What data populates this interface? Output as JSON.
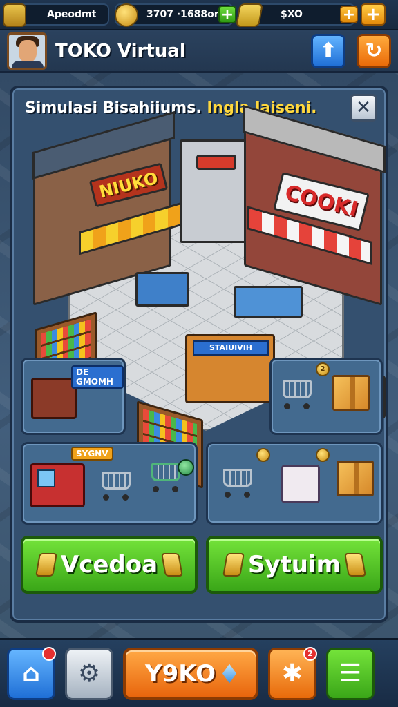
{
  "resources": {
    "player_label": "Apeodmt",
    "coins": "3707 ·1688ors",
    "gold": "$XO"
  },
  "header": {
    "title": "TOKO Virtual"
  },
  "panel": {
    "title_main": "Simulasi Bisahiiums.",
    "title_highlight": "Ingla laiseni.",
    "signs": {
      "left_store": "NIUKO",
      "right_store": "COOKI",
      "counter": "STAIUIVIH"
    },
    "tiles": {
      "tile1_label": "DE GMOMH",
      "tile3_label": "SYGNV",
      "badge_value": "2"
    },
    "buttons": {
      "left_label": "Vcedoa",
      "right_label": "Sytuim"
    }
  },
  "bottom": {
    "main_label": "Y9KO",
    "notif_count": "2"
  },
  "icons": [
    "coin-stack-icon",
    "coin-icon",
    "gold-bar-icon",
    "plus-icon",
    "arrow-up-icon",
    "refresh-icon",
    "close-icon",
    "home-icon",
    "settings-icon",
    "gem-icon",
    "puzzle-icon",
    "menu-icon"
  ]
}
